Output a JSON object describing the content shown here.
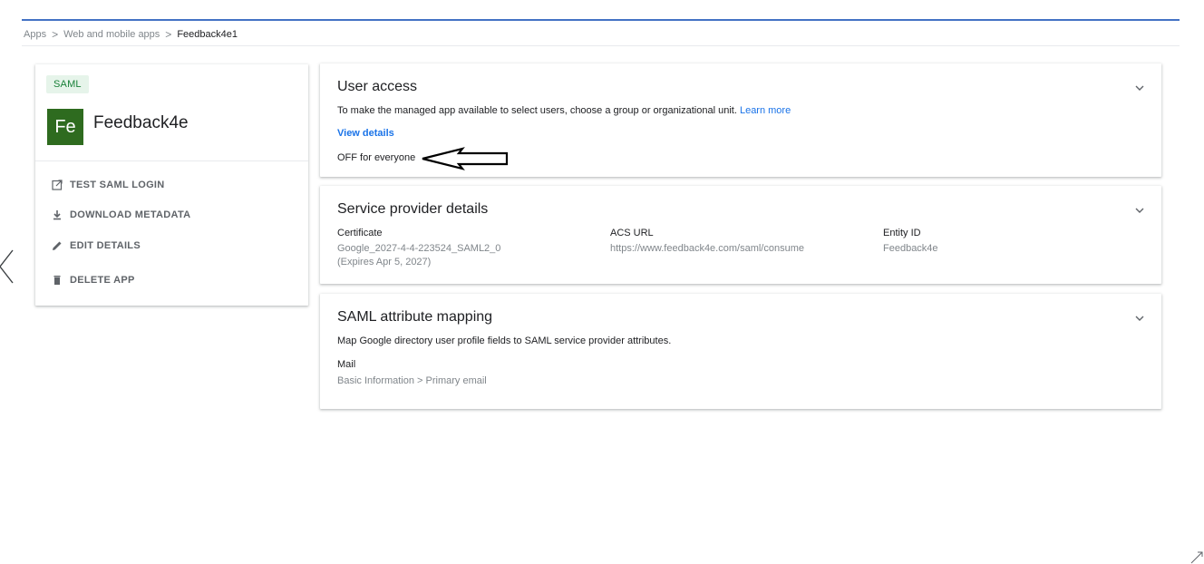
{
  "breadcrumb": {
    "items": [
      "Apps",
      "Web and mobile apps",
      "Feedback4e1"
    ],
    "separator": ">"
  },
  "app": {
    "type_chip": "SAML",
    "logo_initials": "Fe",
    "name": "Feedback4e",
    "logo_color": "#2e6b1f",
    "actions": [
      {
        "label": "TEST SAML LOGIN",
        "icon": "open-in-new-icon"
      },
      {
        "label": "DOWNLOAD METADATA",
        "icon": "download-icon"
      },
      {
        "label": "EDIT DETAILS",
        "icon": "pencil-icon"
      },
      {
        "label": "DELETE APP",
        "icon": "trash-icon"
      }
    ]
  },
  "user_access": {
    "title": "User access",
    "description": "To make the managed app available to select users, choose a group or organizational unit.",
    "learn_more": "Learn more",
    "view_details": "View details",
    "status": "OFF for everyone"
  },
  "service_provider": {
    "title": "Service provider details",
    "certificate_label": "Certificate",
    "certificate_value": "Google_2027-4-4-223524_SAML2_0",
    "certificate_expiry": "(Expires Apr 5, 2027)",
    "acs_label": "ACS URL",
    "acs_value": "https://www.feedback4e.com/saml/consume",
    "entity_label": "Entity ID",
    "entity_value": "Feedback4e"
  },
  "attribute_mapping": {
    "title": "SAML attribute mapping",
    "description": "Map Google directory user profile fields to SAML service provider attributes.",
    "attr_name": "Mail",
    "attr_value": "Basic Information > Primary email"
  },
  "colors": {
    "accent": "#1a73e8",
    "chip_bg": "#e6f4ea",
    "chip_text": "#188038",
    "top_rule": "#4472c4"
  }
}
